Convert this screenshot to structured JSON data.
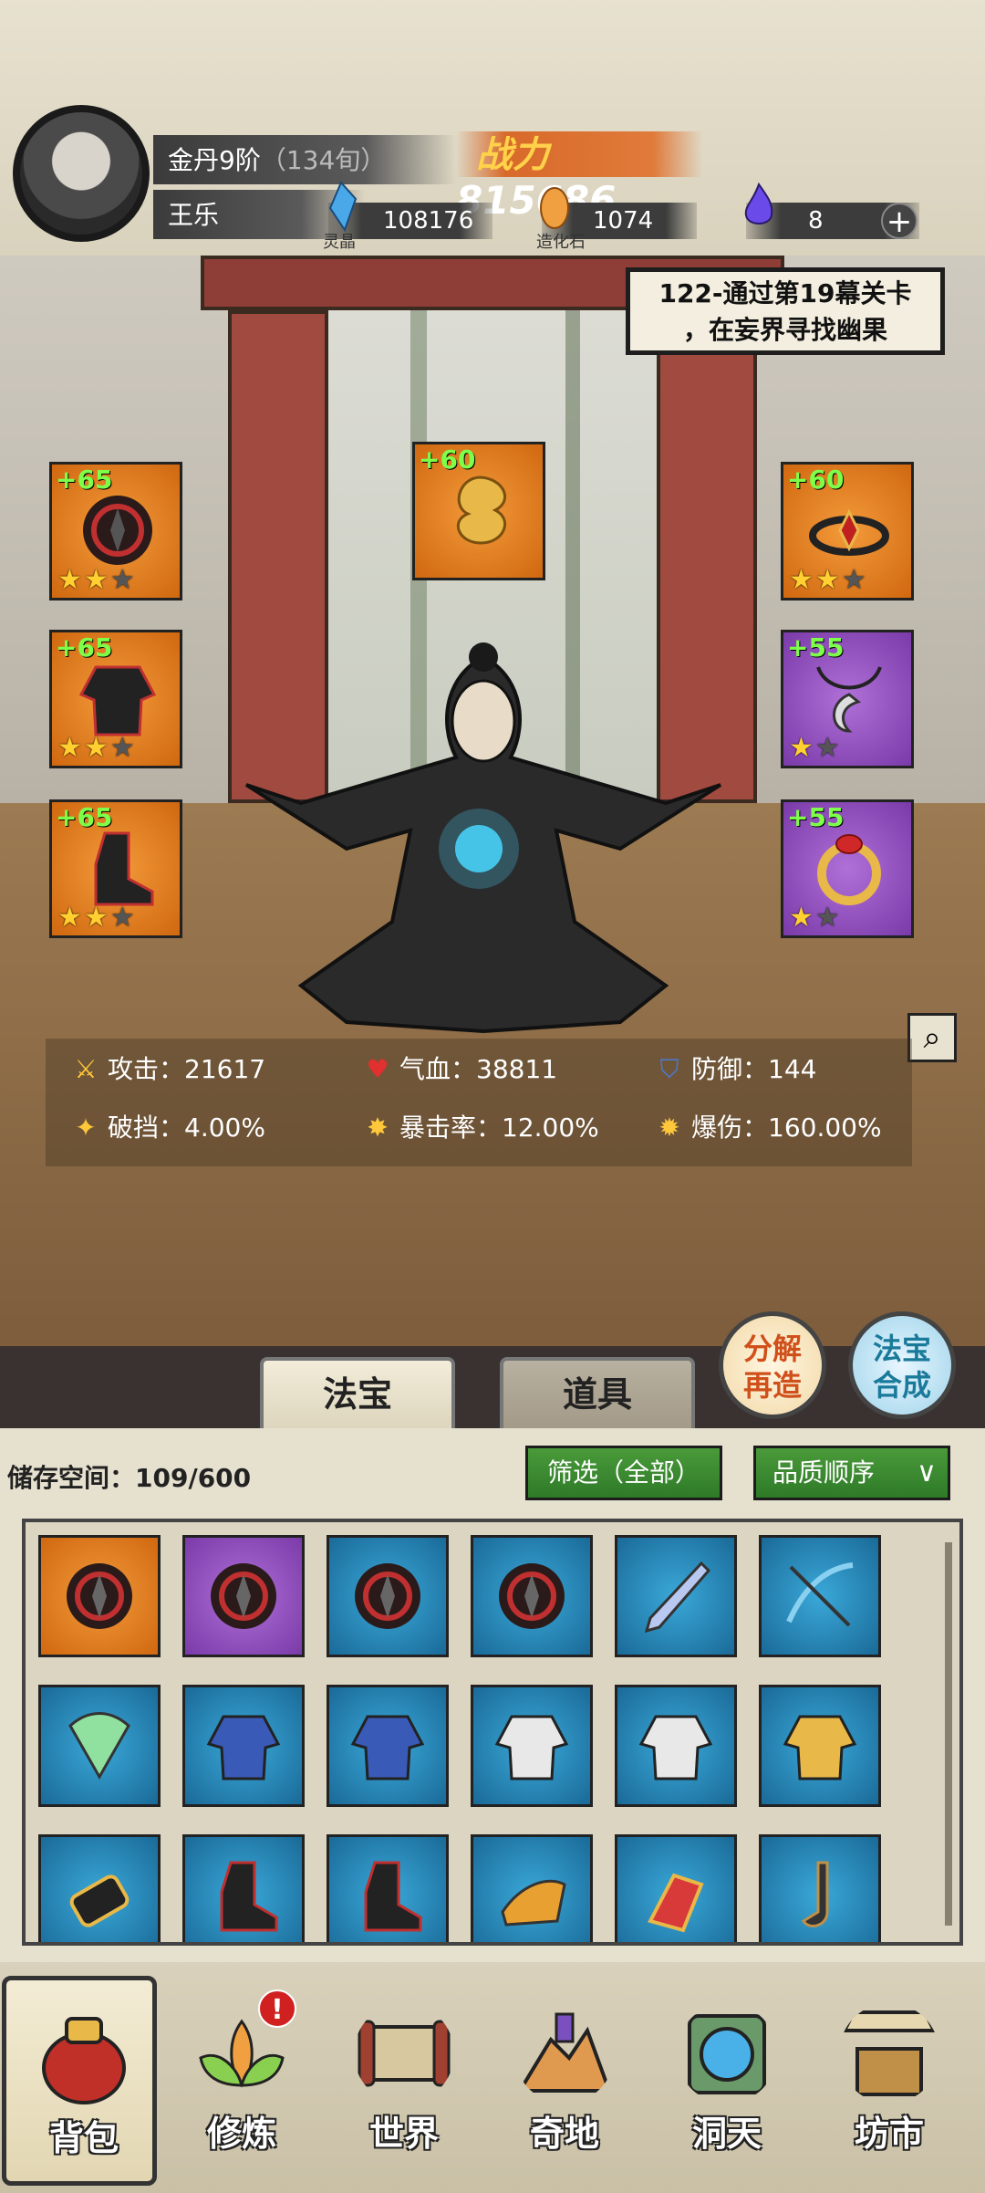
{
  "player": {
    "rank": "金丹9阶",
    "rank_detail": "（134旬）",
    "name": "王乐",
    "power_label": "战力",
    "power_value": "815686"
  },
  "resources": [
    {
      "name": "灵晶",
      "value": "108176",
      "icon": "blue-crystal-icon"
    },
    {
      "name": "造化石",
      "value": "1074",
      "icon": "golden-stone-icon"
    },
    {
      "name": "",
      "value": "8",
      "icon": "purple-flame-icon"
    }
  ],
  "quest": {
    "text_line1": "122-通过第19幕关卡",
    "text_line2": "，在妄界寻找幽果"
  },
  "equipment": {
    "left": [
      {
        "bonus": "+65",
        "stars": 2,
        "max": 3,
        "rarity": "orange",
        "icon": "spiked-wheel-icon"
      },
      {
        "bonus": "+65",
        "stars": 2,
        "max": 3,
        "rarity": "orange",
        "icon": "robe-armor-icon"
      },
      {
        "bonus": "+65",
        "stars": 2,
        "max": 3,
        "rarity": "orange",
        "icon": "boots-icon"
      }
    ],
    "center": {
      "bonus": "+60",
      "rarity": "orange",
      "icon": "golden-cloud-icon"
    },
    "right": [
      {
        "bonus": "+60",
        "stars": 2,
        "max": 3,
        "rarity": "orange",
        "icon": "crown-headband-icon"
      },
      {
        "bonus": "+55",
        "stars": 1,
        "max": 2,
        "rarity": "purple",
        "icon": "necklace-icon"
      },
      {
        "bonus": "+55",
        "stars": 1,
        "max": 2,
        "rarity": "purple",
        "icon": "golden-ring-icon"
      }
    ]
  },
  "stats": [
    {
      "label": "攻击：",
      "value": "21617",
      "icon": "sword-icon"
    },
    {
      "label": "气血：",
      "value": "38811",
      "icon": "heart-icon"
    },
    {
      "label": "防御：",
      "value": "144",
      "icon": "shield-icon"
    },
    {
      "label": "破挡：",
      "value": "4.00%",
      "icon": "break-icon"
    },
    {
      "label": "暴击率：",
      "value": "12.00%",
      "icon": "crit-icon"
    },
    {
      "label": "爆伤：",
      "value": "160.00%",
      "icon": "crit-damage-icon"
    }
  ],
  "tabs": {
    "tab1": "法宝",
    "tab2": "道具"
  },
  "actions": {
    "decompose_line1": "分解",
    "decompose_line2": "再造",
    "synth_line1": "法宝",
    "synth_line2": "合成"
  },
  "inventory": {
    "storage_label": "储存空间：",
    "storage_value": "109/600",
    "filter_label": "筛选（全部）",
    "sort_label": "品质顺序",
    "items": [
      {
        "rarity": "orange",
        "icon": "spiked-wheel-icon"
      },
      {
        "rarity": "purple",
        "icon": "spiked-wheel-icon"
      },
      {
        "rarity": "blue",
        "icon": "spiked-wheel-icon"
      },
      {
        "rarity": "blue",
        "icon": "spiked-wheel-icon"
      },
      {
        "rarity": "blue",
        "icon": "sword-blade-icon"
      },
      {
        "rarity": "blue",
        "icon": "crossbow-icon"
      },
      {
        "rarity": "blue",
        "icon": "fan-icon"
      },
      {
        "rarity": "blue",
        "icon": "blue-robe-icon"
      },
      {
        "rarity": "blue",
        "icon": "blue-robe-icon"
      },
      {
        "rarity": "blue",
        "icon": "white-robe-icon"
      },
      {
        "rarity": "blue",
        "icon": "white-robe-icon"
      },
      {
        "rarity": "blue",
        "icon": "golden-armor-icon"
      },
      {
        "rarity": "blue",
        "icon": "bracer-icon"
      },
      {
        "rarity": "blue",
        "icon": "boots-icon"
      },
      {
        "rarity": "blue",
        "icon": "boots-icon"
      },
      {
        "rarity": "blue",
        "icon": "golden-boot-icon"
      },
      {
        "rarity": "blue",
        "icon": "red-gauntlet-icon"
      },
      {
        "rarity": "blue",
        "icon": "hook-blade-icon"
      }
    ]
  },
  "nav": [
    {
      "label": "背包",
      "icon": "bag-icon",
      "active": true
    },
    {
      "label": "修炼",
      "icon": "lotus-icon",
      "badge": "!"
    },
    {
      "label": "世界",
      "icon": "scroll-map-icon"
    },
    {
      "label": "奇地",
      "icon": "mountain-pagoda-icon"
    },
    {
      "label": "洞天",
      "icon": "portal-icon"
    },
    {
      "label": "坊市",
      "icon": "market-stall-icon"
    }
  ],
  "colors": {
    "orange": "#e07a1e",
    "purple": "#8e4cbf",
    "blue": "#2484b8",
    "bonus_green": "#7dff4a",
    "star_gold": "#ffd030"
  }
}
